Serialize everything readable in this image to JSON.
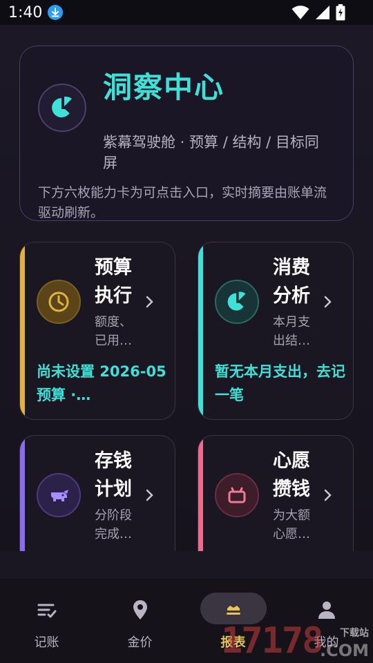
{
  "status_bar": {
    "time": "1:40",
    "icons": [
      "download-icon",
      "wifi-icon",
      "signal-icon",
      "battery-icon"
    ]
  },
  "hero": {
    "title": "洞察中心",
    "subtitle": "紫幕驾驶舱 · 预算 / 结构 / 目标同屏",
    "description": "下方六枚能力卡为可点击入口，实时摘要由账单流驱动刷新。",
    "icon": "insight-icon"
  },
  "cards": [
    {
      "title": "预算执行",
      "desc": "额度、已用…",
      "status": "尚未设置 2026-05 预算 ·…",
      "icon": "clock-icon",
      "accent": "#e0b43c"
    },
    {
      "title": "消费分析",
      "desc": "本月支出结…",
      "status": "暂无本月支出，去记一笔",
      "icon": "insight-icon",
      "accent": "#3ee0d8"
    },
    {
      "title": "存钱计划",
      "desc": "分阶段完成…",
      "status": "",
      "icon": "piggy-bank-icon",
      "accent": "#8a6cf0"
    },
    {
      "title": "心愿攒钱",
      "desc": "为大额心愿…",
      "status": "",
      "icon": "gift-box-icon",
      "accent": "#f06a8c"
    }
  ],
  "nav": {
    "items": [
      {
        "label": "记账",
        "icon": "list-check-icon"
      },
      {
        "label": "金价",
        "icon": "location-pin-icon"
      },
      {
        "label": "报表",
        "icon": "crown-icon",
        "active": true
      },
      {
        "label": "我的",
        "icon": "person-icon"
      }
    ]
  },
  "watermark": {
    "number": "17178",
    "tag": "下载站",
    "domain": ".COM"
  },
  "colors": {
    "accent_teal": "#3ee0d8",
    "accent_gold": "#e7c35a",
    "background": "#1a1622"
  }
}
